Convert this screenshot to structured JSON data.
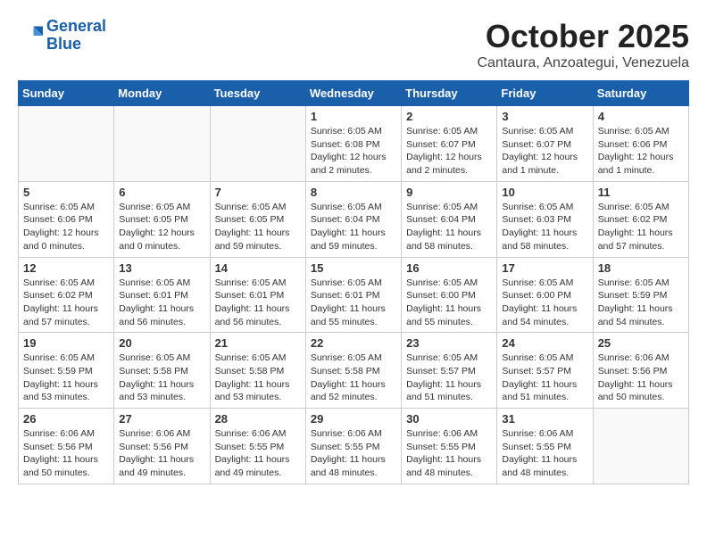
{
  "header": {
    "logo_line1": "General",
    "logo_line2": "Blue",
    "month": "October 2025",
    "location": "Cantaura, Anzoategui, Venezuela"
  },
  "weekdays": [
    "Sunday",
    "Monday",
    "Tuesday",
    "Wednesday",
    "Thursday",
    "Friday",
    "Saturday"
  ],
  "weeks": [
    [
      {
        "day": "",
        "info": ""
      },
      {
        "day": "",
        "info": ""
      },
      {
        "day": "",
        "info": ""
      },
      {
        "day": "1",
        "info": "Sunrise: 6:05 AM\nSunset: 6:08 PM\nDaylight: 12 hours and 2 minutes."
      },
      {
        "day": "2",
        "info": "Sunrise: 6:05 AM\nSunset: 6:07 PM\nDaylight: 12 hours and 2 minutes."
      },
      {
        "day": "3",
        "info": "Sunrise: 6:05 AM\nSunset: 6:07 PM\nDaylight: 12 hours and 1 minute."
      },
      {
        "day": "4",
        "info": "Sunrise: 6:05 AM\nSunset: 6:06 PM\nDaylight: 12 hours and 1 minute."
      }
    ],
    [
      {
        "day": "5",
        "info": "Sunrise: 6:05 AM\nSunset: 6:06 PM\nDaylight: 12 hours and 0 minutes."
      },
      {
        "day": "6",
        "info": "Sunrise: 6:05 AM\nSunset: 6:05 PM\nDaylight: 12 hours and 0 minutes."
      },
      {
        "day": "7",
        "info": "Sunrise: 6:05 AM\nSunset: 6:05 PM\nDaylight: 11 hours and 59 minutes."
      },
      {
        "day": "8",
        "info": "Sunrise: 6:05 AM\nSunset: 6:04 PM\nDaylight: 11 hours and 59 minutes."
      },
      {
        "day": "9",
        "info": "Sunrise: 6:05 AM\nSunset: 6:04 PM\nDaylight: 11 hours and 58 minutes."
      },
      {
        "day": "10",
        "info": "Sunrise: 6:05 AM\nSunset: 6:03 PM\nDaylight: 11 hours and 58 minutes."
      },
      {
        "day": "11",
        "info": "Sunrise: 6:05 AM\nSunset: 6:02 PM\nDaylight: 11 hours and 57 minutes."
      }
    ],
    [
      {
        "day": "12",
        "info": "Sunrise: 6:05 AM\nSunset: 6:02 PM\nDaylight: 11 hours and 57 minutes."
      },
      {
        "day": "13",
        "info": "Sunrise: 6:05 AM\nSunset: 6:01 PM\nDaylight: 11 hours and 56 minutes."
      },
      {
        "day": "14",
        "info": "Sunrise: 6:05 AM\nSunset: 6:01 PM\nDaylight: 11 hours and 56 minutes."
      },
      {
        "day": "15",
        "info": "Sunrise: 6:05 AM\nSunset: 6:01 PM\nDaylight: 11 hours and 55 minutes."
      },
      {
        "day": "16",
        "info": "Sunrise: 6:05 AM\nSunset: 6:00 PM\nDaylight: 11 hours and 55 minutes."
      },
      {
        "day": "17",
        "info": "Sunrise: 6:05 AM\nSunset: 6:00 PM\nDaylight: 11 hours and 54 minutes."
      },
      {
        "day": "18",
        "info": "Sunrise: 6:05 AM\nSunset: 5:59 PM\nDaylight: 11 hours and 54 minutes."
      }
    ],
    [
      {
        "day": "19",
        "info": "Sunrise: 6:05 AM\nSunset: 5:59 PM\nDaylight: 11 hours and 53 minutes."
      },
      {
        "day": "20",
        "info": "Sunrise: 6:05 AM\nSunset: 5:58 PM\nDaylight: 11 hours and 53 minutes."
      },
      {
        "day": "21",
        "info": "Sunrise: 6:05 AM\nSunset: 5:58 PM\nDaylight: 11 hours and 53 minutes."
      },
      {
        "day": "22",
        "info": "Sunrise: 6:05 AM\nSunset: 5:58 PM\nDaylight: 11 hours and 52 minutes."
      },
      {
        "day": "23",
        "info": "Sunrise: 6:05 AM\nSunset: 5:57 PM\nDaylight: 11 hours and 51 minutes."
      },
      {
        "day": "24",
        "info": "Sunrise: 6:05 AM\nSunset: 5:57 PM\nDaylight: 11 hours and 51 minutes."
      },
      {
        "day": "25",
        "info": "Sunrise: 6:06 AM\nSunset: 5:56 PM\nDaylight: 11 hours and 50 minutes."
      }
    ],
    [
      {
        "day": "26",
        "info": "Sunrise: 6:06 AM\nSunset: 5:56 PM\nDaylight: 11 hours and 50 minutes."
      },
      {
        "day": "27",
        "info": "Sunrise: 6:06 AM\nSunset: 5:56 PM\nDaylight: 11 hours and 49 minutes."
      },
      {
        "day": "28",
        "info": "Sunrise: 6:06 AM\nSunset: 5:55 PM\nDaylight: 11 hours and 49 minutes."
      },
      {
        "day": "29",
        "info": "Sunrise: 6:06 AM\nSunset: 5:55 PM\nDaylight: 11 hours and 48 minutes."
      },
      {
        "day": "30",
        "info": "Sunrise: 6:06 AM\nSunset: 5:55 PM\nDaylight: 11 hours and 48 minutes."
      },
      {
        "day": "31",
        "info": "Sunrise: 6:06 AM\nSunset: 5:55 PM\nDaylight: 11 hours and 48 minutes."
      },
      {
        "day": "",
        "info": ""
      }
    ]
  ]
}
